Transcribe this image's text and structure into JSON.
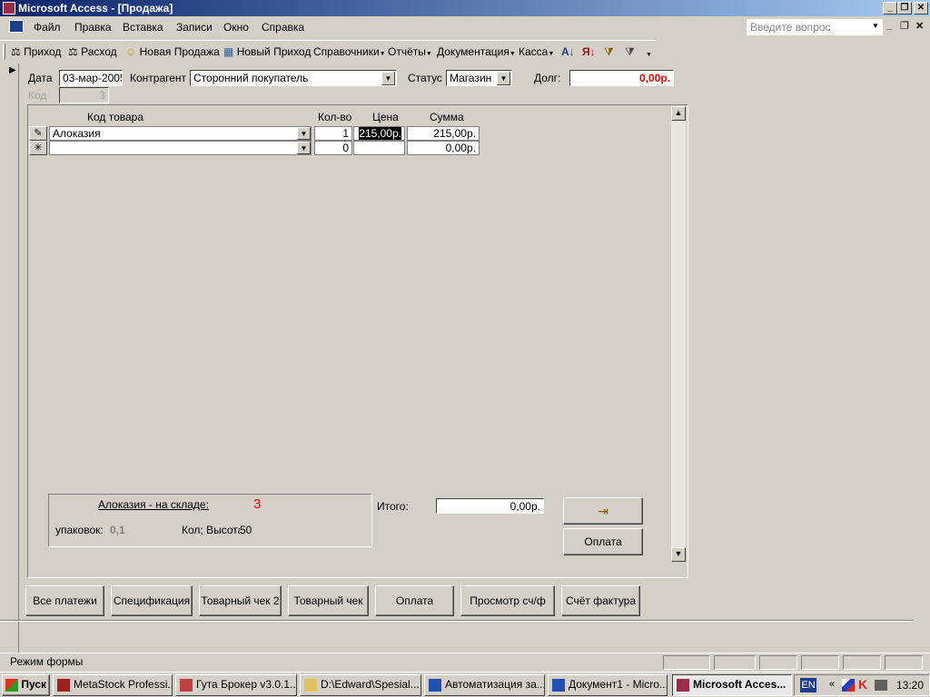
{
  "window": {
    "title": "Microsoft Access - [Продажа]"
  },
  "menu": {
    "items": [
      "Файл",
      "Правка",
      "Вставка",
      "Записи",
      "Окно",
      "Справка"
    ],
    "help_placeholder": "Введите вопрос"
  },
  "toolbar": {
    "prihod": "Приход",
    "rashod": "Расход",
    "new_sale": "Новая Продажа",
    "new_prihod": "Новый Приход",
    "spravochniki": "Справочники",
    "otchety": "Отчёты",
    "dokumentaciya": "Документация",
    "kassa": "Касса"
  },
  "form": {
    "date_label": "Дата",
    "date_value": "03-мар-2005",
    "kontragent_label": "Контрагент",
    "kontragent_value": "Сторонний покупатель",
    "status_label": "Статус",
    "status_value": "Магазин",
    "dolg_label": "Долг:",
    "dolg_value": "0,00р.",
    "kod_label": "Код",
    "kod_value": "3"
  },
  "table": {
    "headers": {
      "code": "Код товара",
      "qty": "Кол-во",
      "price": "Цена",
      "sum": "Сумма"
    },
    "rows": [
      {
        "code": "Алоказия",
        "qty": "1",
        "price": "215,00р.",
        "sum": "215,00р."
      },
      {
        "code": "",
        "qty": "0",
        "price": "",
        "sum": "0,00р."
      }
    ]
  },
  "stock": {
    "title": "Алоказия - на складе:",
    "count": "3",
    "pack_label": "упаковок:",
    "pack_value": "0,1",
    "height_label": "Кол; Высота",
    "height_value": "50"
  },
  "totals": {
    "label": "Итого:",
    "value": "0,00р."
  },
  "buttons": {
    "oplata_inner": "Оплата",
    "all_payments": "Все платежи",
    "specification": "Спецификация",
    "check2": "Товарный чек 2",
    "check": "Товарный чек",
    "oplata": "Оплата",
    "view_invoice": "Просмотр сч/ф",
    "invoice": "Счёт фактура"
  },
  "status": {
    "mode": "Режим формы"
  },
  "taskbar": {
    "start": "Пуск",
    "tasks": [
      "MetaStock Professi...",
      "Гута Брокер v3.0.1...",
      "D:\\Edward\\Spesial...",
      "Автоматизация за...",
      "Документ1 - Micro...",
      "Microsoft Acces..."
    ],
    "lang": "EN",
    "clock": "13:20"
  },
  "colors": {
    "title_start": "#0a246a",
    "dolg_text": "#ff0000",
    "stock_count": "#ff0000"
  }
}
